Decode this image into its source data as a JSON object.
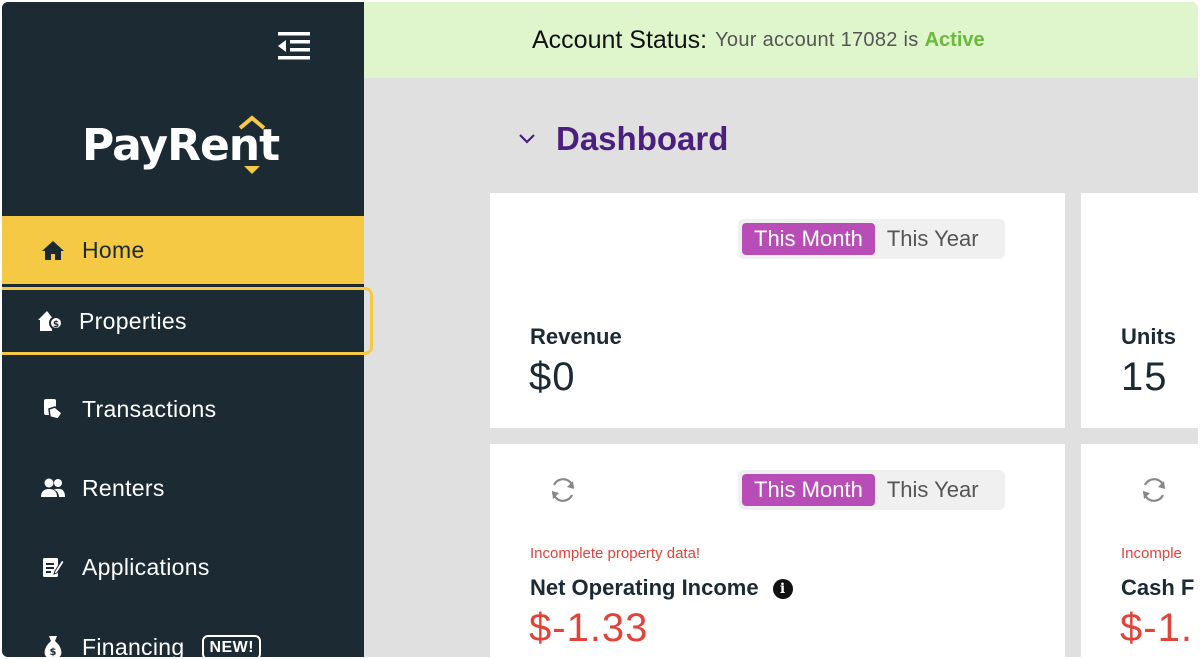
{
  "sidebar": {
    "logo_text": "PayRent",
    "items": [
      {
        "label": "Home",
        "icon": "home-icon"
      },
      {
        "label": "Properties",
        "icon": "property-icon"
      },
      {
        "label": "Transactions",
        "icon": "transactions-icon"
      },
      {
        "label": "Renters",
        "icon": "renters-icon"
      },
      {
        "label": "Applications",
        "icon": "applications-icon"
      },
      {
        "label": "Financing",
        "icon": "financing-icon",
        "badge": "NEW!"
      }
    ]
  },
  "status": {
    "title": "Account Status:",
    "text": "Your account 17082 is",
    "state": "Active"
  },
  "dashboard": {
    "title": "Dashboard"
  },
  "toggle": {
    "this_month": "This Month",
    "this_year": "This Year"
  },
  "cards": {
    "revenue": {
      "label": "Revenue",
      "value": "$0"
    },
    "units": {
      "label": "Units",
      "value": "15"
    },
    "noi": {
      "warning": "Incomplete property data!",
      "label": "Net Operating Income",
      "info": "i",
      "value": "$-1.33"
    },
    "cash": {
      "warning": "Incomple",
      "label": "Cash F",
      "value": "$-1."
    }
  },
  "colors": {
    "sidebar_bg": "#1b2a33",
    "accent_yellow": "#f6c945",
    "toggle_active": "#b94db7",
    "title_purple": "#4b1f7d",
    "negative_red": "#e0433a",
    "active_green": "#6ab93c",
    "status_bg": "#dff5cc"
  }
}
